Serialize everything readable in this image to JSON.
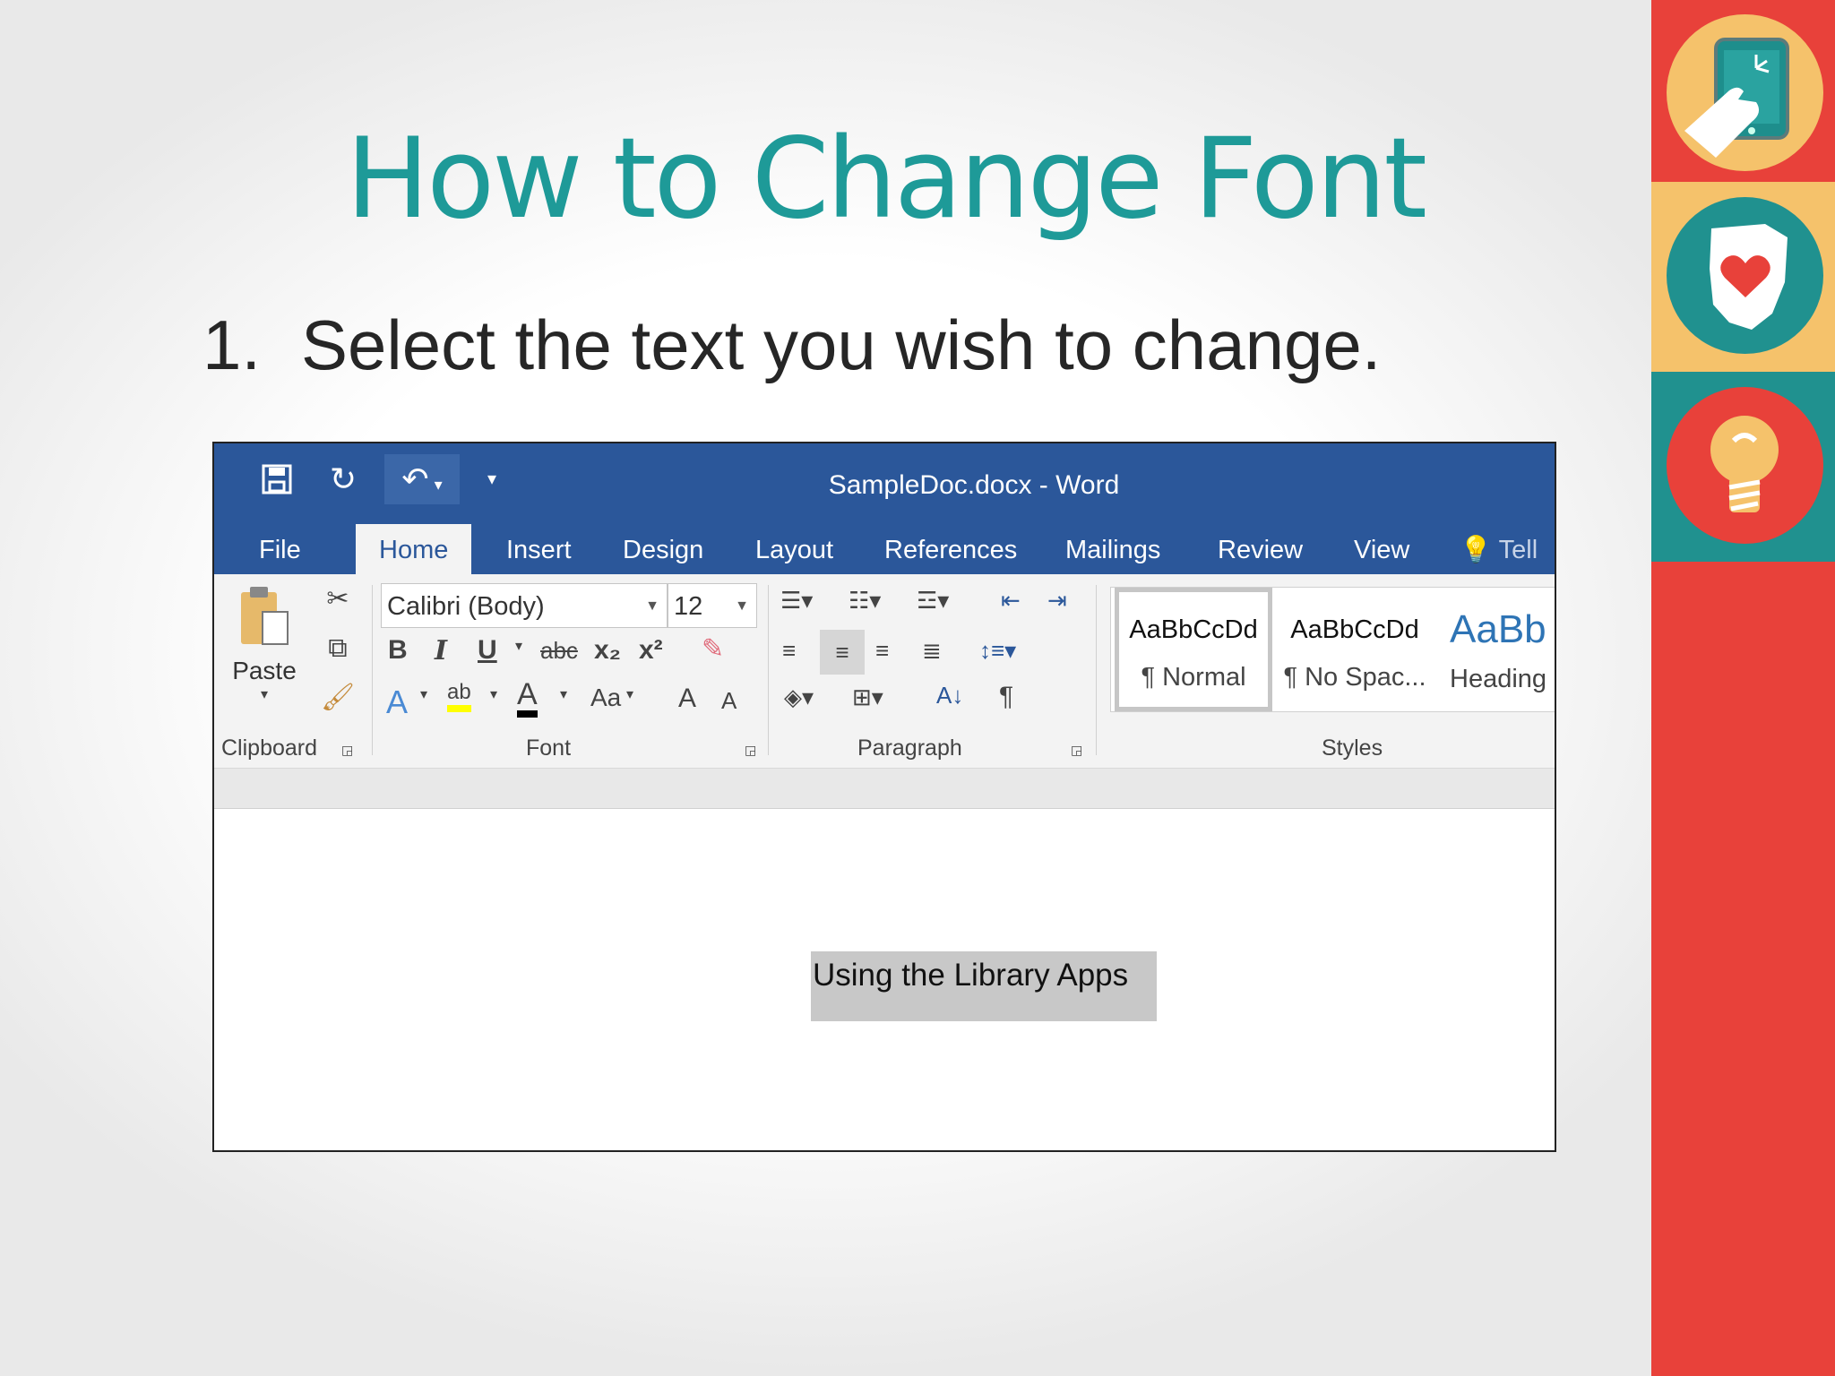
{
  "slide": {
    "title": "How to Change Font",
    "step_number": "1.",
    "step_text": "Select the text you wish to change."
  },
  "word": {
    "window_title": "SampleDoc.docx - Word",
    "tabs": [
      "File",
      "Home",
      "Insert",
      "Design",
      "Layout",
      "References",
      "Mailings",
      "Review",
      "View"
    ],
    "active_tab": "Home",
    "tell_me": "Tell",
    "clipboard": {
      "paste_label": "Paste",
      "group_label": "Clipboard"
    },
    "font": {
      "name": "Calibri (Body)",
      "size": "12",
      "group_label": "Font",
      "bold": "B",
      "italic": "I",
      "underline": "U",
      "strike": "abc",
      "subscript": "x₂",
      "superscript": "x²",
      "change_case": "Aa",
      "text_effects": "A",
      "highlight": "ab",
      "font_color": "A",
      "grow": "A",
      "shrink": "A"
    },
    "paragraph": {
      "group_label": "Paragraph",
      "pilcrow": "¶",
      "sort": "A↓"
    },
    "styles": {
      "group_label": "Styles",
      "items": [
        {
          "preview": "AaBbCcDd",
          "name": "¶ Normal"
        },
        {
          "preview": "AaBbCcDd",
          "name": "¶ No Spac..."
        },
        {
          "preview": "AaBb",
          "name": "Heading"
        }
      ]
    },
    "document": {
      "selected_text": "Using the Library Apps"
    }
  },
  "colors": {
    "title_teal": "#1e9a98",
    "word_blue": "#2b579a",
    "side_red": "#e8413a",
    "side_yellow": "#f5c26b",
    "side_teal": "#20918f"
  }
}
